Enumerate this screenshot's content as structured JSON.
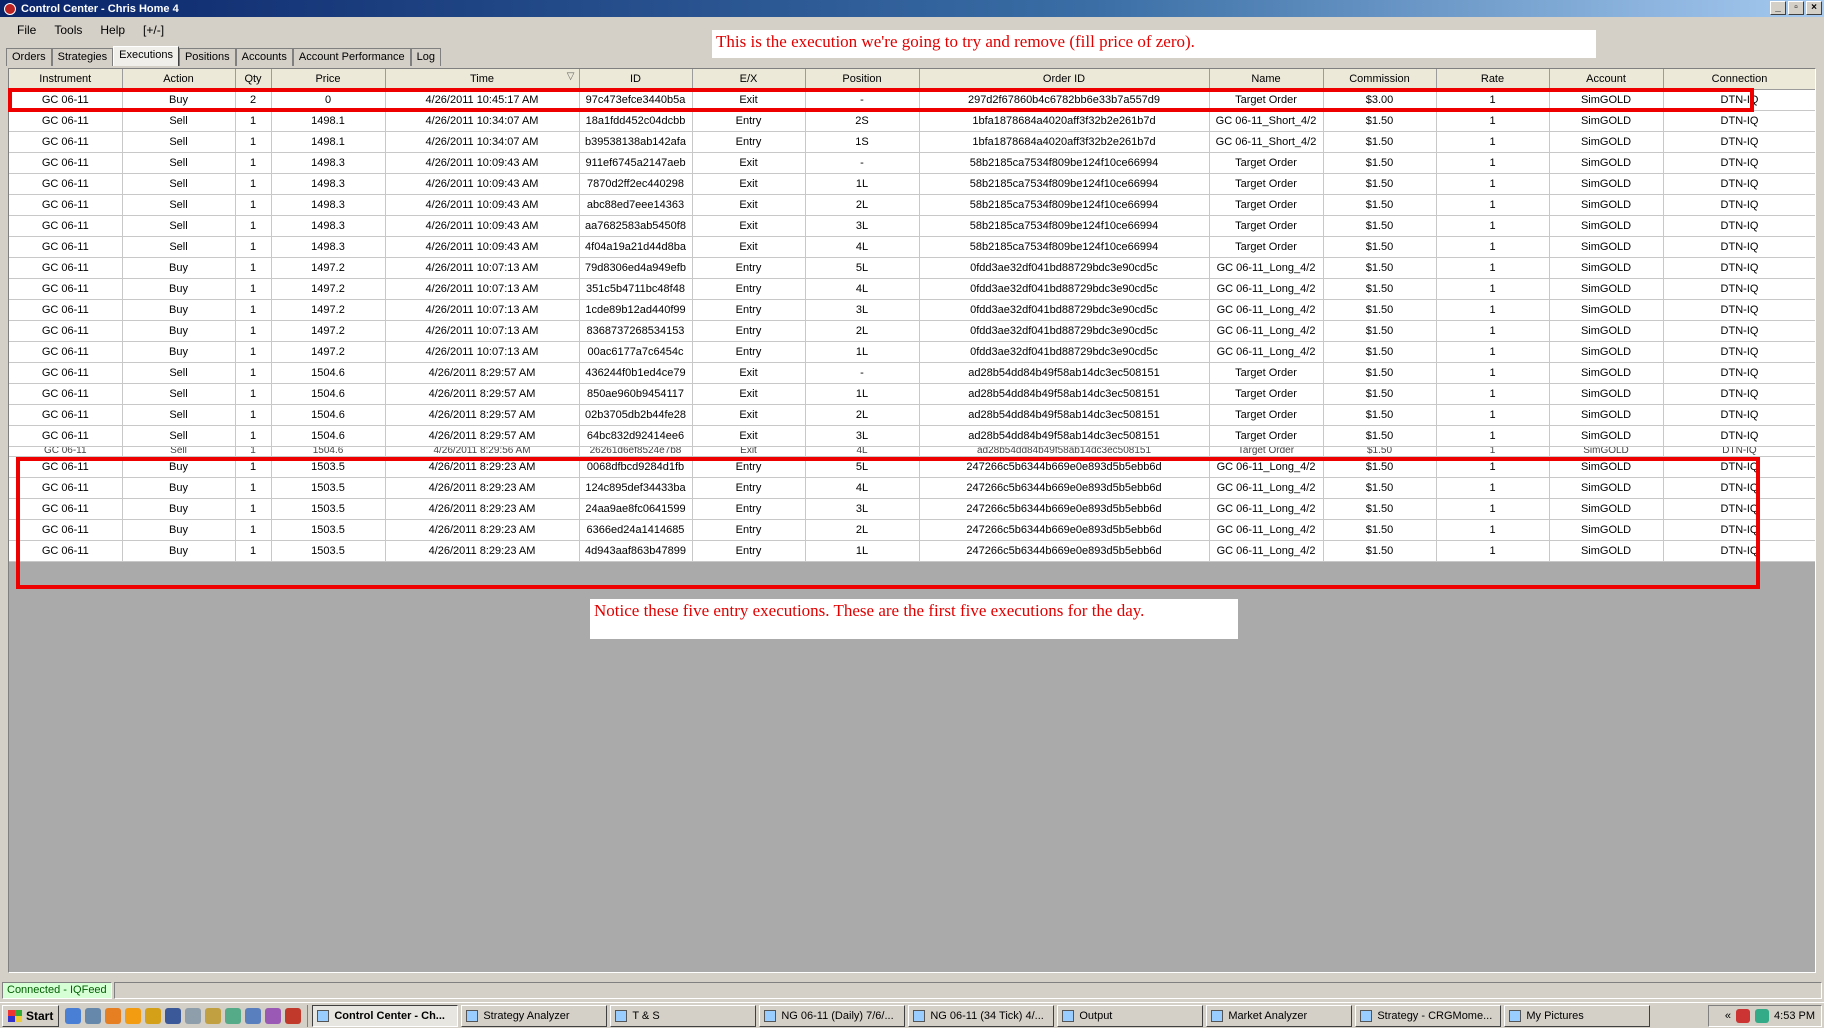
{
  "window": {
    "title": "Control Center - Chris Home 4",
    "min_glyph": "_",
    "max_glyph": "▫",
    "close_glyph": "×"
  },
  "menu": [
    "File",
    "Tools",
    "Help",
    "[+/-]"
  ],
  "tabs": [
    {
      "label": "Orders",
      "active": false
    },
    {
      "label": "Strategies",
      "active": false
    },
    {
      "label": "Executions",
      "active": true
    },
    {
      "label": "Positions",
      "active": false
    },
    {
      "label": "Accounts",
      "active": false
    },
    {
      "label": "Account Performance",
      "active": false
    },
    {
      "label": "Log",
      "active": false
    }
  ],
  "annotations": {
    "top": "This is the execution we're going to try and remove (fill price of zero).",
    "bottom": "Notice these five entry executions.  These are the first five executions for the day."
  },
  "colors": {
    "annotation_red": "#e00000",
    "status_green_bg": "#d6ffd6"
  },
  "grid": {
    "columns": [
      "Instrument",
      "Action",
      "Qty",
      "Price",
      "Time",
      "ID",
      "E/X",
      "Position",
      "Order ID",
      "Name",
      "Commission",
      "Rate",
      "Account",
      "Connection"
    ],
    "sort_indicator": "▽",
    "rows": [
      [
        "GC 06-11",
        "Buy",
        "2",
        "0",
        "4/26/2011 10:45:17 AM",
        "97c473efce3440b5a",
        "Exit",
        "-",
        "297d2f67860b4c6782bb6e33b7a557d9",
        "Target Order",
        "$3.00",
        "1",
        "SimGOLD",
        "DTN-IQ"
      ],
      [
        "GC 06-11",
        "Sell",
        "1",
        "1498.1",
        "4/26/2011 10:34:07 AM",
        "18a1fdd452c04dcbb",
        "Entry",
        "2S",
        "1bfa1878684a4020aff3f32b2e261b7d",
        "GC 06-11_Short_4/2",
        "$1.50",
        "1",
        "SimGOLD",
        "DTN-IQ"
      ],
      [
        "GC 06-11",
        "Sell",
        "1",
        "1498.1",
        "4/26/2011 10:34:07 AM",
        "b39538138ab142afa",
        "Entry",
        "1S",
        "1bfa1878684a4020aff3f32b2e261b7d",
        "GC 06-11_Short_4/2",
        "$1.50",
        "1",
        "SimGOLD",
        "DTN-IQ"
      ],
      [
        "GC 06-11",
        "Sell",
        "1",
        "1498.3",
        "4/26/2011 10:09:43 AM",
        "911ef6745a2147aeb",
        "Exit",
        "-",
        "58b2185ca7534f809be124f10ce66994",
        "Target Order",
        "$1.50",
        "1",
        "SimGOLD",
        "DTN-IQ"
      ],
      [
        "GC 06-11",
        "Sell",
        "1",
        "1498.3",
        "4/26/2011 10:09:43 AM",
        "7870d2ff2ec440298",
        "Exit",
        "1L",
        "58b2185ca7534f809be124f10ce66994",
        "Target Order",
        "$1.50",
        "1",
        "SimGOLD",
        "DTN-IQ"
      ],
      [
        "GC 06-11",
        "Sell",
        "1",
        "1498.3",
        "4/26/2011 10:09:43 AM",
        "abc88ed7eee14363",
        "Exit",
        "2L",
        "58b2185ca7534f809be124f10ce66994",
        "Target Order",
        "$1.50",
        "1",
        "SimGOLD",
        "DTN-IQ"
      ],
      [
        "GC 06-11",
        "Sell",
        "1",
        "1498.3",
        "4/26/2011 10:09:43 AM",
        "aa7682583ab5450f8",
        "Exit",
        "3L",
        "58b2185ca7534f809be124f10ce66994",
        "Target Order",
        "$1.50",
        "1",
        "SimGOLD",
        "DTN-IQ"
      ],
      [
        "GC 06-11",
        "Sell",
        "1",
        "1498.3",
        "4/26/2011 10:09:43 AM",
        "4f04a19a21d44d8ba",
        "Exit",
        "4L",
        "58b2185ca7534f809be124f10ce66994",
        "Target Order",
        "$1.50",
        "1",
        "SimGOLD",
        "DTN-IQ"
      ],
      [
        "GC 06-11",
        "Buy",
        "1",
        "1497.2",
        "4/26/2011 10:07:13 AM",
        "79d8306ed4a949efb",
        "Entry",
        "5L",
        "0fdd3ae32df041bd88729bdc3e90cd5c",
        "GC 06-11_Long_4/2",
        "$1.50",
        "1",
        "SimGOLD",
        "DTN-IQ"
      ],
      [
        "GC 06-11",
        "Buy",
        "1",
        "1497.2",
        "4/26/2011 10:07:13 AM",
        "351c5b4711bc48f48",
        "Entry",
        "4L",
        "0fdd3ae32df041bd88729bdc3e90cd5c",
        "GC 06-11_Long_4/2",
        "$1.50",
        "1",
        "SimGOLD",
        "DTN-IQ"
      ],
      [
        "GC 06-11",
        "Buy",
        "1",
        "1497.2",
        "4/26/2011 10:07:13 AM",
        "1cde89b12ad440f99",
        "Entry",
        "3L",
        "0fdd3ae32df041bd88729bdc3e90cd5c",
        "GC 06-11_Long_4/2",
        "$1.50",
        "1",
        "SimGOLD",
        "DTN-IQ"
      ],
      [
        "GC 06-11",
        "Buy",
        "1",
        "1497.2",
        "4/26/2011 10:07:13 AM",
        "8368737268534153",
        "Entry",
        "2L",
        "0fdd3ae32df041bd88729bdc3e90cd5c",
        "GC 06-11_Long_4/2",
        "$1.50",
        "1",
        "SimGOLD",
        "DTN-IQ"
      ],
      [
        "GC 06-11",
        "Buy",
        "1",
        "1497.2",
        "4/26/2011 10:07:13 AM",
        "00ac6177a7c6454c",
        "Entry",
        "1L",
        "0fdd3ae32df041bd88729bdc3e90cd5c",
        "GC 06-11_Long_4/2",
        "$1.50",
        "1",
        "SimGOLD",
        "DTN-IQ"
      ],
      [
        "GC 06-11",
        "Sell",
        "1",
        "1504.6",
        "4/26/2011 8:29:57 AM",
        "436244f0b1ed4ce79",
        "Exit",
        "-",
        "ad28b54dd84b49f58ab14dc3ec508151",
        "Target Order",
        "$1.50",
        "1",
        "SimGOLD",
        "DTN-IQ"
      ],
      [
        "GC 06-11",
        "Sell",
        "1",
        "1504.6",
        "4/26/2011 8:29:57 AM",
        "850ae960b9454117",
        "Exit",
        "1L",
        "ad28b54dd84b49f58ab14dc3ec508151",
        "Target Order",
        "$1.50",
        "1",
        "SimGOLD",
        "DTN-IQ"
      ],
      [
        "GC 06-11",
        "Sell",
        "1",
        "1504.6",
        "4/26/2011 8:29:57 AM",
        "02b3705db2b44fe28",
        "Exit",
        "2L",
        "ad28b54dd84b49f58ab14dc3ec508151",
        "Target Order",
        "$1.50",
        "1",
        "SimGOLD",
        "DTN-IQ"
      ],
      [
        "GC 06-11",
        "Sell",
        "1",
        "1504.6",
        "4/26/2011 8:29:57 AM",
        "64bc832d92414ee6",
        "Exit",
        "3L",
        "ad28b54dd84b49f58ab14dc3ec508151",
        "Target Order",
        "$1.50",
        "1",
        "SimGOLD",
        "DTN-IQ"
      ]
    ],
    "partial_row": [
      "GC 06-11",
      "Sell",
      "1",
      "1504.6",
      "4/26/2011 8:29:56 AM",
      "26261d6ef8524e7b8",
      "Exit",
      "4L",
      "ad28b54dd84b49f58ab14dc3ec508151",
      "Target Order",
      "$1.50",
      "1",
      "SimGOLD",
      "DTN-IQ"
    ],
    "lower_rows": [
      [
        "GC 06-11",
        "Buy",
        "1",
        "1503.5",
        "4/26/2011 8:29:23 AM",
        "0068dfbcd9284d1fb",
        "Entry",
        "5L",
        "247266c5b6344b669e0e893d5b5ebb6d",
        "GC 06-11_Long_4/2",
        "$1.50",
        "1",
        "SimGOLD",
        "DTN-IQ"
      ],
      [
        "GC 06-11",
        "Buy",
        "1",
        "1503.5",
        "4/26/2011 8:29:23 AM",
        "124c895def34433ba",
        "Entry",
        "4L",
        "247266c5b6344b669e0e893d5b5ebb6d",
        "GC 06-11_Long_4/2",
        "$1.50",
        "1",
        "SimGOLD",
        "DTN-IQ"
      ],
      [
        "GC 06-11",
        "Buy",
        "1",
        "1503.5",
        "4/26/2011 8:29:23 AM",
        "24aa9ae8fc0641599",
        "Entry",
        "3L",
        "247266c5b6344b669e0e893d5b5ebb6d",
        "GC 06-11_Long_4/2",
        "$1.50",
        "1",
        "SimGOLD",
        "DTN-IQ"
      ],
      [
        "GC 06-11",
        "Buy",
        "1",
        "1503.5",
        "4/26/2011 8:29:23 AM",
        "6366ed24a1414685",
        "Entry",
        "2L",
        "247266c5b6344b669e0e893d5b5ebb6d",
        "GC 06-11_Long_4/2",
        "$1.50",
        "1",
        "SimGOLD",
        "DTN-IQ"
      ],
      [
        "GC 06-11",
        "Buy",
        "1",
        "1503.5",
        "4/26/2011 8:29:23 AM",
        "4d943aaf863b47899",
        "Entry",
        "1L",
        "247266c5b6344b669e0e893d5b5ebb6d",
        "GC 06-11_Long_4/2",
        "$1.50",
        "1",
        "SimGOLD",
        "DTN-IQ"
      ]
    ]
  },
  "status": {
    "connection": "Connected - IQFeed"
  },
  "taskbar": {
    "start_label": "Start",
    "quicklaunch_icons": [
      "ie-icon",
      "show-desktop-icon",
      "firefox-icon",
      "vlc-icon",
      "app-icon",
      "notepad-icon",
      "calculator-icon",
      "app-icon",
      "app-icon",
      "outlook-icon",
      "app-icon",
      "ninjatrader-icon"
    ],
    "tasks": [
      {
        "label": "Control Center - Ch...",
        "active": true
      },
      {
        "label": "Strategy Analyzer",
        "active": false
      },
      {
        "label": "T & S",
        "active": false
      },
      {
        "label": "NG 06-11 (Daily)  7/6/...",
        "active": false
      },
      {
        "label": "NG 06-11 (34 Tick)  4/...",
        "active": false
      },
      {
        "label": "Output",
        "active": false
      },
      {
        "label": "Market Analyzer",
        "active": false
      },
      {
        "label": "Strategy - CRGMome...",
        "active": false
      },
      {
        "label": "My Pictures",
        "active": false
      }
    ],
    "tray_chevron": "«",
    "clock": "4:53 PM"
  }
}
